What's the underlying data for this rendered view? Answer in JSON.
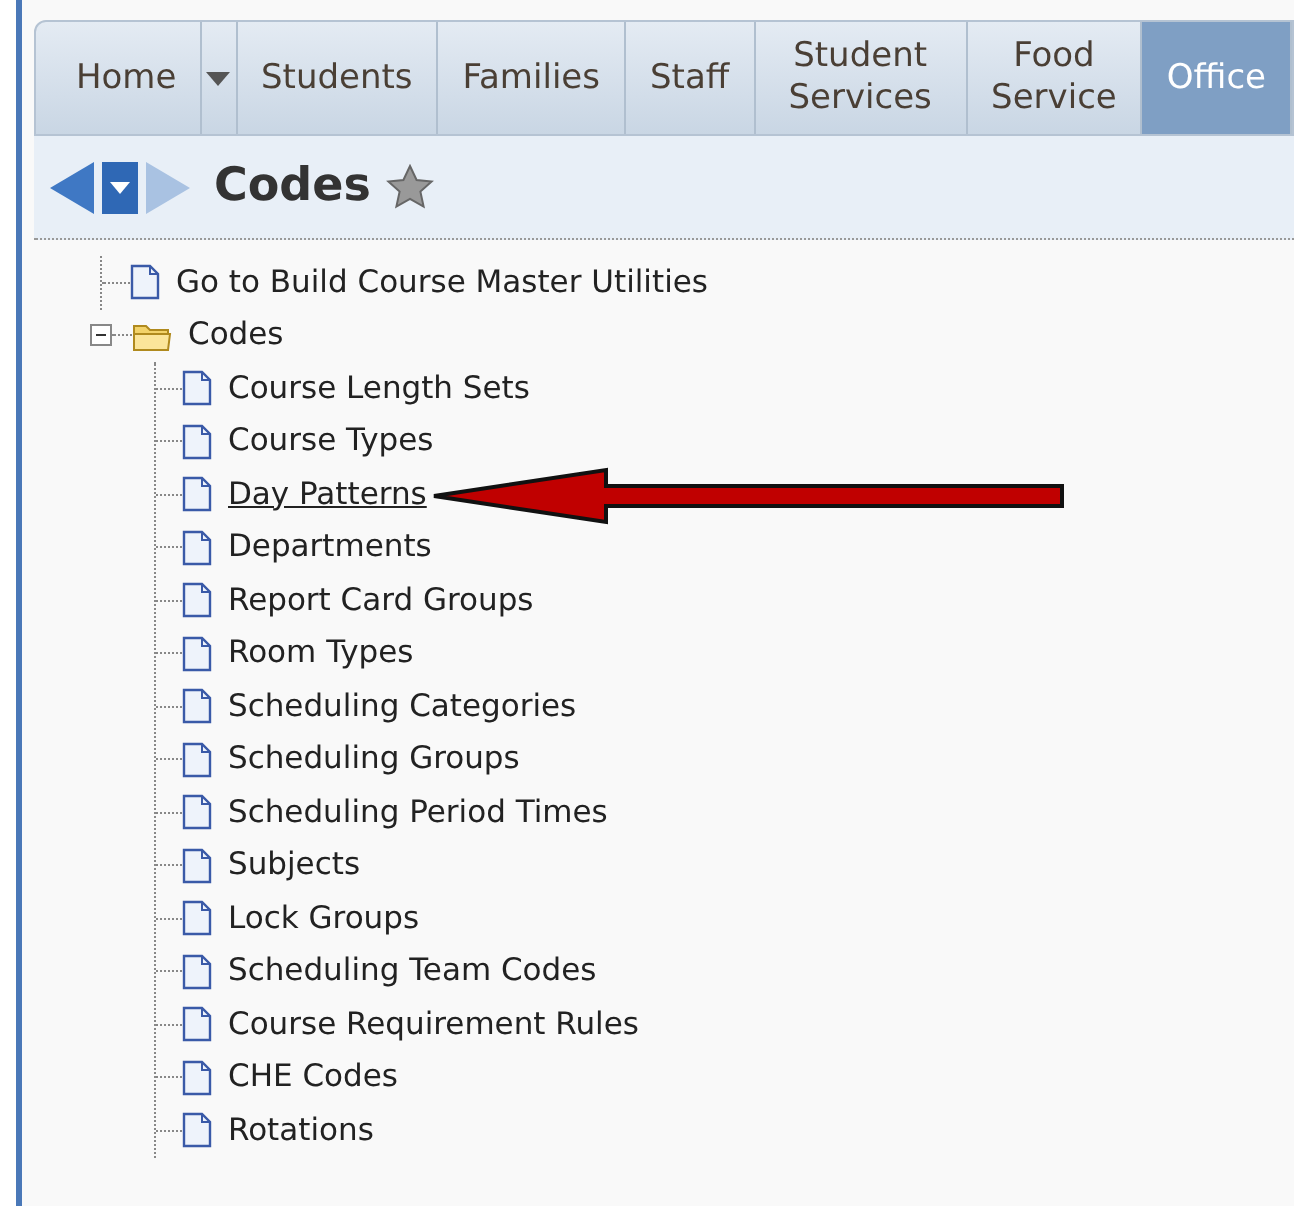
{
  "nav_tabs": [
    {
      "label": "Home",
      "kind": "tab",
      "selected": false
    },
    {
      "kind": "dropdown",
      "selected": false
    },
    {
      "label": "Students",
      "kind": "tab",
      "selected": false
    },
    {
      "label": "Families",
      "kind": "tab",
      "selected": false
    },
    {
      "label": "Staff",
      "kind": "tab",
      "selected": false
    },
    {
      "label": "Student Services",
      "kind": "tab",
      "selected": false
    },
    {
      "label": "Food Service",
      "kind": "tab",
      "selected": false
    },
    {
      "label": "Office",
      "kind": "tab",
      "selected": true
    }
  ],
  "page_title": "Codes",
  "tree": [
    {
      "label": "Go to Build Course Master Utilities",
      "kind": "page",
      "selected": false,
      "pointed": false
    },
    {
      "label": "Codes",
      "kind": "folder",
      "expanded": true,
      "selected": false,
      "pointed": false,
      "children": [
        {
          "label": "Course Length Sets",
          "kind": "page",
          "selected": false,
          "pointed": false
        },
        {
          "label": "Course Types",
          "kind": "page",
          "selected": false,
          "pointed": false
        },
        {
          "label": "Day Patterns",
          "kind": "page",
          "selected": true,
          "pointed": true
        },
        {
          "label": "Departments",
          "kind": "page",
          "selected": false,
          "pointed": false
        },
        {
          "label": "Report Card Groups",
          "kind": "page",
          "selected": false,
          "pointed": false
        },
        {
          "label": "Room Types",
          "kind": "page",
          "selected": false,
          "pointed": false
        },
        {
          "label": "Scheduling Categories",
          "kind": "page",
          "selected": false,
          "pointed": false
        },
        {
          "label": "Scheduling Groups",
          "kind": "page",
          "selected": false,
          "pointed": false
        },
        {
          "label": "Scheduling Period Times",
          "kind": "page",
          "selected": false,
          "pointed": false
        },
        {
          "label": "Subjects",
          "kind": "page",
          "selected": false,
          "pointed": false
        },
        {
          "label": "Lock Groups",
          "kind": "page",
          "selected": false,
          "pointed": false
        },
        {
          "label": "Scheduling Team Codes",
          "kind": "page",
          "selected": false,
          "pointed": false
        },
        {
          "label": "Course Requirement Rules",
          "kind": "page",
          "selected": false,
          "pointed": false
        },
        {
          "label": "CHE Codes",
          "kind": "page",
          "selected": false,
          "pointed": false
        },
        {
          "label": "Rotations",
          "kind": "page",
          "selected": false,
          "pointed": false
        }
      ]
    }
  ]
}
